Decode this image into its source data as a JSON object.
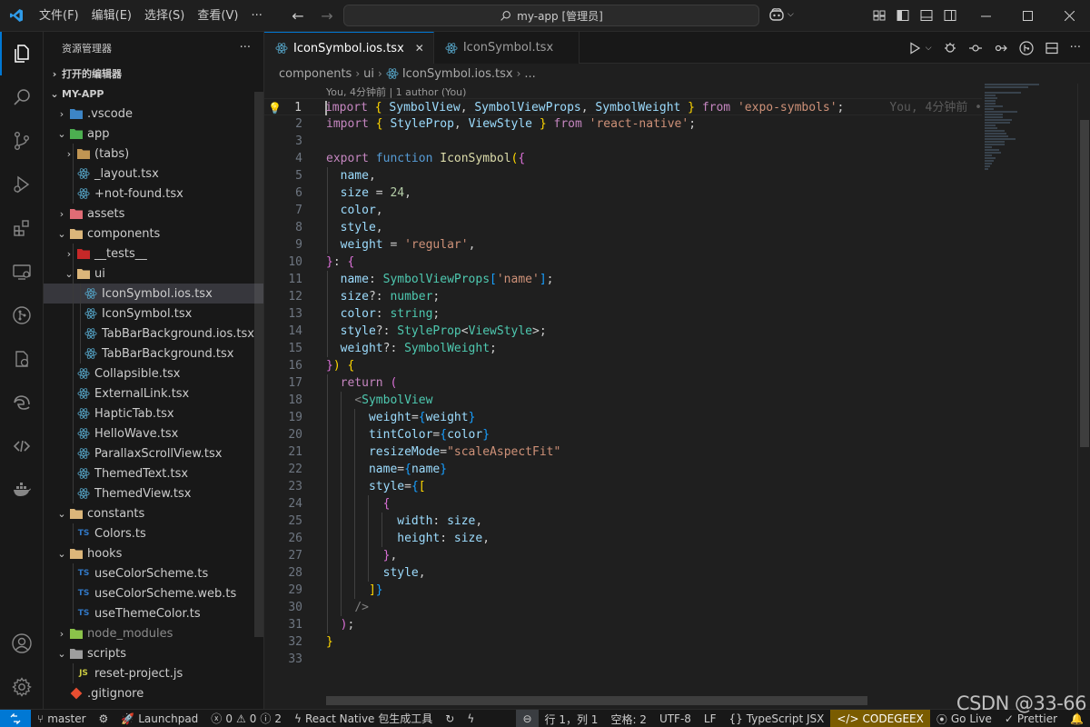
{
  "titlebar": {
    "menu": [
      "文件(F)",
      "编辑(E)",
      "选择(S)",
      "查看(V)",
      "···"
    ],
    "search_text": "my-app [管理员]",
    "window_controls": [
      "minimize",
      "maximize",
      "close"
    ]
  },
  "sidebar": {
    "title": "资源管理器",
    "more": "···",
    "open_editors": "打开的编辑器",
    "project": "MY-APP",
    "tree": [
      {
        "label": ".vscode",
        "type": "folder",
        "depth": 1,
        "open": false,
        "color": "#3d85c6"
      },
      {
        "label": "app",
        "type": "folder",
        "depth": 1,
        "open": true,
        "color": "#4caf50"
      },
      {
        "label": "(tabs)",
        "type": "folder",
        "depth": 2,
        "open": false,
        "color": "#c09553"
      },
      {
        "label": "_layout.tsx",
        "type": "react",
        "depth": 2
      },
      {
        "label": "+not-found.tsx",
        "type": "react",
        "depth": 2
      },
      {
        "label": "assets",
        "type": "folder",
        "depth": 1,
        "open": false,
        "color": "#e06c75"
      },
      {
        "label": "components",
        "type": "folder",
        "depth": 1,
        "open": true,
        "color": "#dcb67a"
      },
      {
        "label": "__tests__",
        "type": "folder",
        "depth": 2,
        "open": false,
        "color": "#c62828"
      },
      {
        "label": "ui",
        "type": "folder",
        "depth": 2,
        "open": true,
        "color": "#dcb67a"
      },
      {
        "label": "IconSymbol.ios.tsx",
        "type": "react",
        "depth": 3,
        "selected": true
      },
      {
        "label": "IconSymbol.tsx",
        "type": "react",
        "depth": 3
      },
      {
        "label": "TabBarBackground.ios.tsx",
        "type": "react",
        "depth": 3
      },
      {
        "label": "TabBarBackground.tsx",
        "type": "react",
        "depth": 3
      },
      {
        "label": "Collapsible.tsx",
        "type": "react",
        "depth": 2
      },
      {
        "label": "ExternalLink.tsx",
        "type": "react",
        "depth": 2
      },
      {
        "label": "HapticTab.tsx",
        "type": "react",
        "depth": 2
      },
      {
        "label": "HelloWave.tsx",
        "type": "react",
        "depth": 2
      },
      {
        "label": "ParallaxScrollView.tsx",
        "type": "react",
        "depth": 2
      },
      {
        "label": "ThemedText.tsx",
        "type": "react",
        "depth": 2
      },
      {
        "label": "ThemedView.tsx",
        "type": "react",
        "depth": 2
      },
      {
        "label": "constants",
        "type": "folder",
        "depth": 1,
        "open": true,
        "color": "#dcb67a"
      },
      {
        "label": "Colors.ts",
        "type": "ts",
        "depth": 2
      },
      {
        "label": "hooks",
        "type": "folder",
        "depth": 1,
        "open": true,
        "color": "#dcb67a"
      },
      {
        "label": "useColorScheme.ts",
        "type": "ts",
        "depth": 2
      },
      {
        "label": "useColorScheme.web.ts",
        "type": "ts",
        "depth": 2
      },
      {
        "label": "useThemeColor.ts",
        "type": "ts",
        "depth": 2
      },
      {
        "label": "node_modules",
        "type": "folder",
        "depth": 1,
        "open": false,
        "color": "#8bc34a",
        "dim": true
      },
      {
        "label": "scripts",
        "type": "folder",
        "depth": 1,
        "open": true,
        "color": "#9e9e9e"
      },
      {
        "label": "reset-project.js",
        "type": "js",
        "depth": 2
      },
      {
        "label": ".gitignore",
        "type": "git",
        "depth": 1
      }
    ]
  },
  "editor": {
    "tabs": [
      {
        "label": "IconSymbol.ios.tsx",
        "active": true
      },
      {
        "label": "IconSymbol.tsx",
        "active": false
      }
    ],
    "breadcrumb": [
      "components",
      "ui",
      "IconSymbol.ios.tsx",
      "..."
    ],
    "codelens": "You, 4分钟前 | 1 author (You)",
    "blame": "You, 4分钟前 •",
    "cursor_line": 1,
    "line_count": 33
  },
  "statusbar": {
    "branch": "master",
    "launchpad": "Launchpad",
    "errors": "0",
    "warnings": "0",
    "info": "2",
    "react_native": "React Native 包生成工具",
    "position": "行 1，列 1",
    "spaces": "空格: 2",
    "encoding": "UTF-8",
    "eol": "LF",
    "language": "TypeScript JSX",
    "codegeex": "CODEGEEX",
    "golive": "Go Live",
    "prettier": "Prettier"
  },
  "watermark": "CSDN @33-66",
  "colors": {
    "accent": "#0078d4",
    "react_icon": "#519aba",
    "ts_badge": "#3178c6",
    "codegeex_bg": "#7a5c00"
  }
}
